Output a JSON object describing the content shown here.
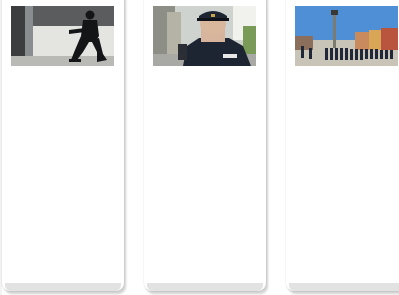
{
  "cards": [
    {
      "photo": "tactical-officer-kneeling-photo"
    },
    {
      "photo": "police-officer-radio-photo"
    },
    {
      "photo": "parade-square-column-photo"
    }
  ],
  "colors": {
    "card_background": "#ffffff",
    "card_footer": "#e2e2e2",
    "police_navy": "#1d2533",
    "sky_blue": "#4f8fd6"
  }
}
